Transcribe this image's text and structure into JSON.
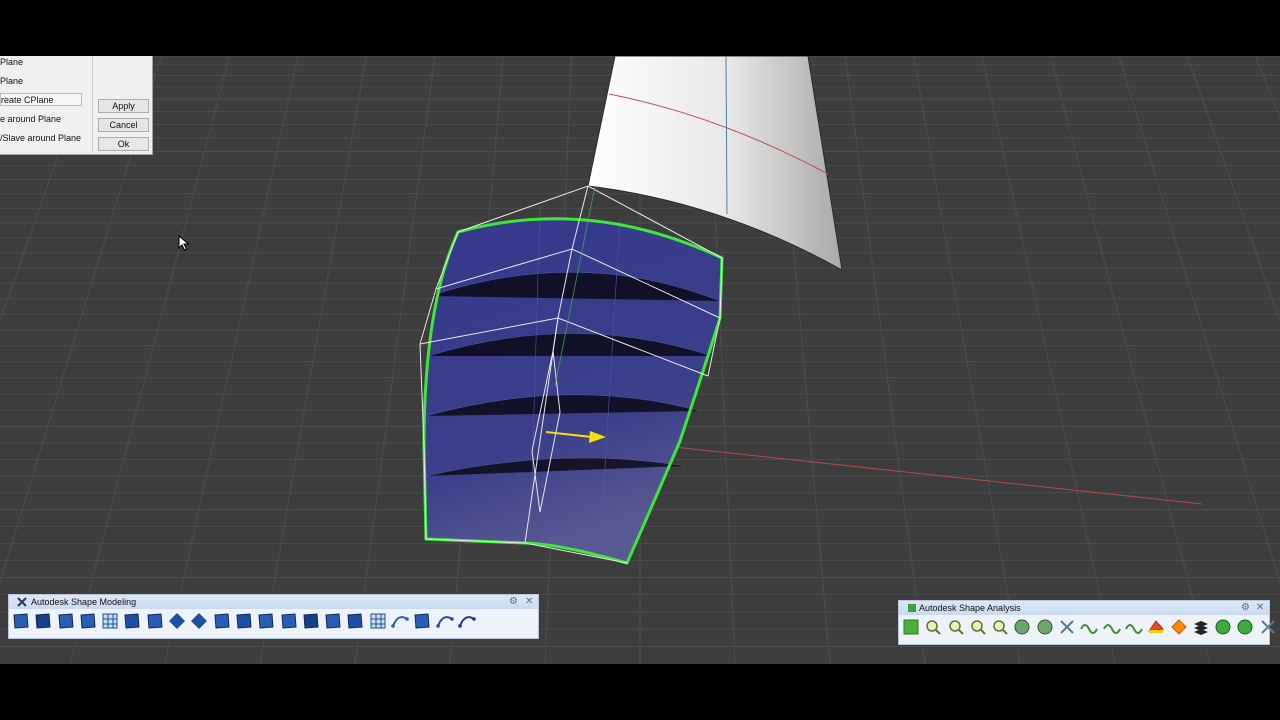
{
  "cplane_panel": {
    "options": [
      "Plane",
      "Plane",
      "reate CPlane",
      "e around Plane",
      "/Slave around Plane"
    ],
    "selected_index": 2,
    "buttons": {
      "apply": "Apply",
      "cancel": "Cancel",
      "ok": "Ok"
    }
  },
  "modeling_toolbar": {
    "title": "Autodesk Shape Modeling",
    "tools": [
      "control-points-icon",
      "offset-icon",
      "surface-fit-icon",
      "blend-icon",
      "grid-icon",
      "plane-surface-icon",
      "patch-icon",
      "diamond-icon",
      "polygon-icon",
      "wedge-icon",
      "fold-icon",
      "align-icon",
      "arrow-icon",
      "mirror-icon",
      "merge-icon",
      "align-edge-icon",
      "network-icon",
      "curve-icon",
      "brush-icon",
      "bend-icon",
      "spline-icon"
    ]
  },
  "analysis_toolbar": {
    "title": "Autodesk Shape Analysis",
    "tools": [
      "analysis-green-icon",
      "zebra-icon",
      "zoom-analysis-icon",
      "zoom-select-icon",
      "zoom-extents-icon",
      "sphere-icon",
      "half-sphere-icon",
      "measure-icon",
      "curvature-wave-icon",
      "deviation-icon",
      "curvature-map-icon",
      "draft-icon",
      "orange-icon",
      "layer-stack-icon",
      "environment-icon",
      "fade-icon",
      "settings-icon"
    ]
  },
  "colors": {
    "selection_outline": "#3ee83a",
    "surface_fill": "#383a8a",
    "gizmo_arrow": "#f2e10b",
    "axis_red": "#c84a4a",
    "grid": "#4a4a4a",
    "viewport_bg": "#3d3d3d"
  }
}
